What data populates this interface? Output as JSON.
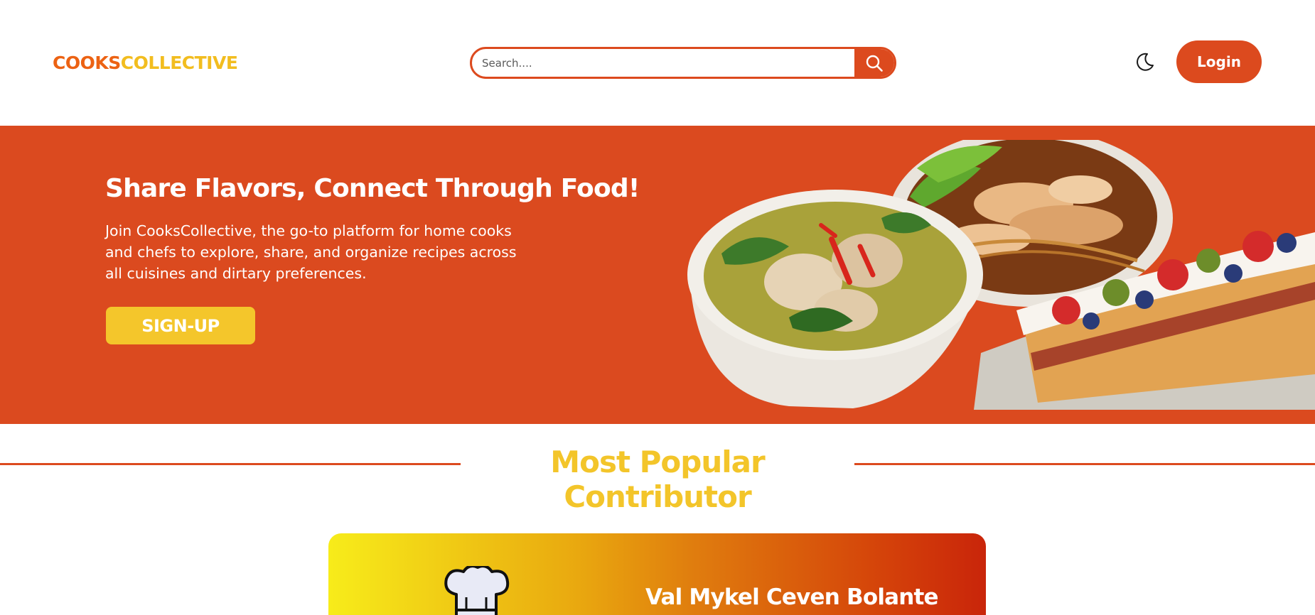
{
  "header": {
    "logo_part1": "COOKS",
    "logo_part2": "COLLECTIVE",
    "search": {
      "placeholder": "Search....",
      "value": ""
    },
    "search_icon": "search-icon",
    "theme_icon": "moon-icon",
    "login_label": "Login"
  },
  "hero": {
    "title": "Share Flavors, Connect Through Food!",
    "description": "Join CooksCollective, the go-to platform for home cooks and chefs to explore, share, and organize recipes across all cuisines and dirtary preferences.",
    "signup_label": "SIGN-UP"
  },
  "section": {
    "title": "Most Popular Contributor"
  },
  "contributor": {
    "name": "Val Mykel Ceven Bolante",
    "avatar_icon": "chef-hat-icon"
  },
  "colors": {
    "brand": "#dc4a1e",
    "accent": "#f3c52a",
    "logo_orange": "#ec6213",
    "logo_yellow": "#f2bd1f"
  }
}
